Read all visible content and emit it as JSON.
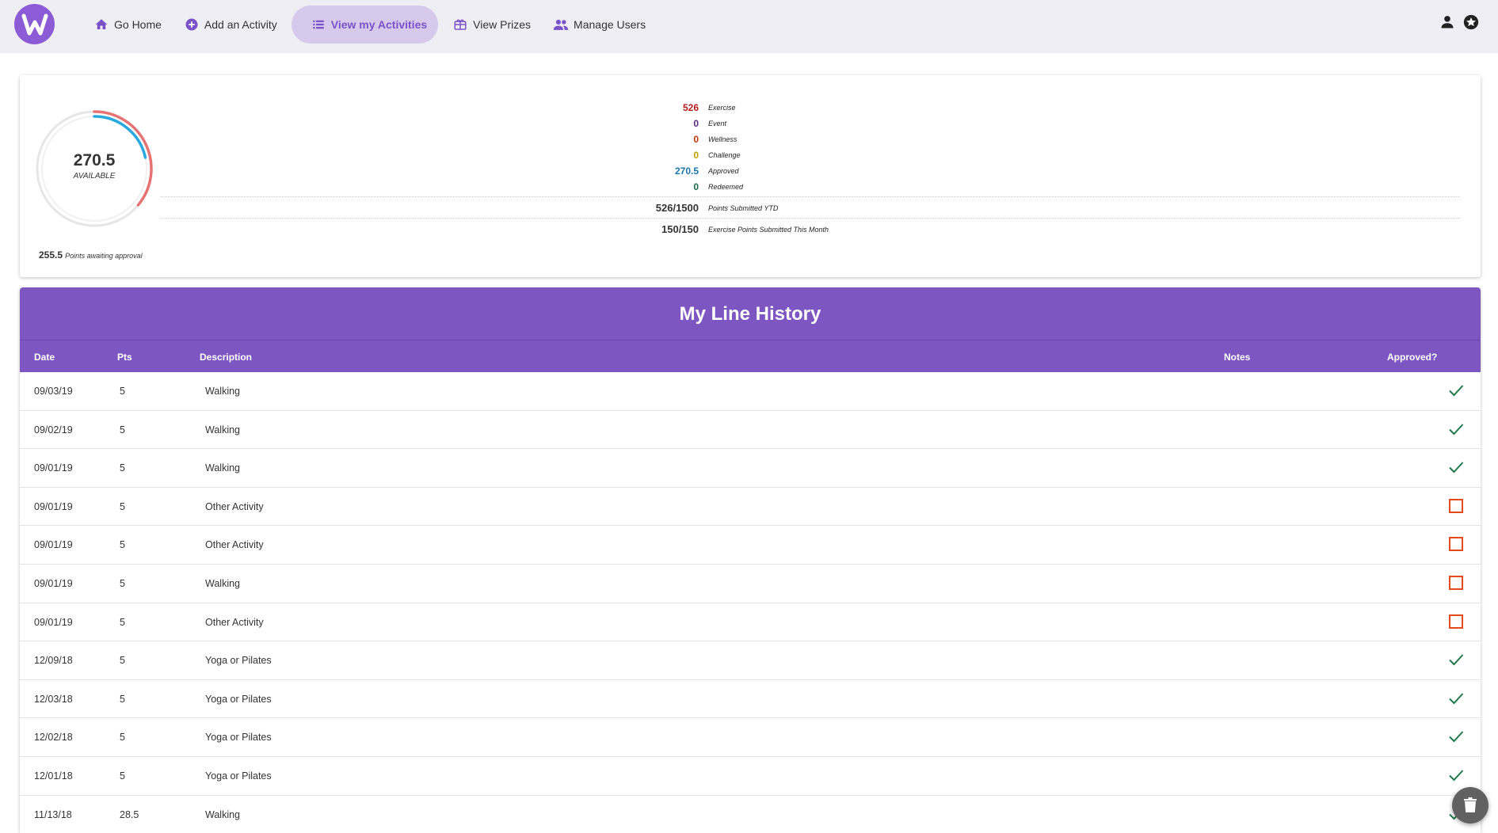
{
  "colors": {
    "brand": "#7d56c2",
    "exercise": "#b71c1c",
    "event": "#5b2c83",
    "wellness": "#bf360c",
    "challenge": "#c0a000",
    "approved": "#1976a8",
    "redeemed": "#1b6b4a",
    "approved_check": "#1f7a4a",
    "pending_box": "#e64a19"
  },
  "nav": {
    "items": [
      {
        "label": "Go Home",
        "icon": "home-icon"
      },
      {
        "label": "Add an Activity",
        "icon": "plus-circle-icon"
      },
      {
        "label": "View my Activities",
        "icon": "list-icon",
        "active": true
      },
      {
        "label": "View Prizes",
        "icon": "gift-icon"
      },
      {
        "label": "Manage Users",
        "icon": "users-icon"
      }
    ],
    "right_icons": [
      "person-icon",
      "star-badge-icon"
    ]
  },
  "summary": {
    "available_value": "270.5",
    "available_label": "AVAILABLE",
    "awaiting_value": "255.5",
    "awaiting_label": "Points awaiting approval",
    "gauge_fraction": 0.36,
    "stats": [
      {
        "value": "526",
        "label": "Exercise"
      },
      {
        "value": "0",
        "label": "Event"
      },
      {
        "value": "0",
        "label": "Wellness"
      },
      {
        "value": "0",
        "label": "Challenge"
      },
      {
        "value": "270.5",
        "label": "Approved"
      },
      {
        "value": "0",
        "label": "Redeemed"
      }
    ],
    "ytd": {
      "value": "526/1500",
      "label": "Points Submitted YTD"
    },
    "month": {
      "value": "150/150",
      "label": "Exercise Points Submitted This Month"
    }
  },
  "history": {
    "title": "My Line History",
    "columns": {
      "date": "Date",
      "pts": "Pts",
      "description": "Description",
      "notes": "Notes",
      "approved": "Approved?"
    },
    "rows": [
      {
        "date": "09/03/19",
        "pts": "5",
        "description": "Walking",
        "approved": true
      },
      {
        "date": "09/02/19",
        "pts": "5",
        "description": "Walking",
        "approved": true
      },
      {
        "date": "09/01/19",
        "pts": "5",
        "description": "Walking",
        "approved": true
      },
      {
        "date": "09/01/19",
        "pts": "5",
        "description": "Other Activity",
        "approved": false
      },
      {
        "date": "09/01/19",
        "pts": "5",
        "description": "Other Activity",
        "approved": false
      },
      {
        "date": "09/01/19",
        "pts": "5",
        "description": "Walking",
        "approved": false
      },
      {
        "date": "09/01/19",
        "pts": "5",
        "description": "Other Activity",
        "approved": false
      },
      {
        "date": "12/09/18",
        "pts": "5",
        "description": "Yoga or Pilates",
        "approved": true
      },
      {
        "date": "12/03/18",
        "pts": "5",
        "description": "Yoga or Pilates",
        "approved": true
      },
      {
        "date": "12/02/18",
        "pts": "5",
        "description": "Yoga or Pilates",
        "approved": true
      },
      {
        "date": "12/01/18",
        "pts": "5",
        "description": "Yoga or Pilates",
        "approved": true
      },
      {
        "date": "11/13/18",
        "pts": "28.5",
        "description": "Walking",
        "approved": true
      }
    ]
  },
  "fab": {
    "icon": "trash-icon"
  }
}
